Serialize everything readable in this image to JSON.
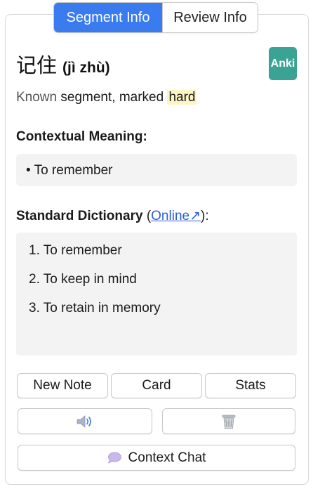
{
  "tabs": [
    {
      "label": "Segment Info",
      "active": true
    },
    {
      "label": "Review Info",
      "active": false
    }
  ],
  "word": {
    "hanzi": "记住",
    "pinyin": "(jì zhù)"
  },
  "anki_badge": "Anki",
  "status": {
    "part1": "Known",
    "part2": " segment, marked ",
    "tag": "hard"
  },
  "contextual": {
    "heading": "Contextual Meaning:",
    "item": "• To remember"
  },
  "dictionary": {
    "heading": "Standard Dictionary",
    "paren_open": " (",
    "link": "Online↗",
    "paren_close": "):",
    "definitions": [
      "1. To remember",
      "2. To keep in mind",
      "3. To retain in memory"
    ]
  },
  "buttons": {
    "new_note": "New Note",
    "card": "Card",
    "stats": "Stats",
    "audio_icon": "speaker-icon",
    "delete_icon": "trash-icon",
    "context_chat": "Context Chat",
    "context_chat_icon": "chat-bubble-icon"
  },
  "colors": {
    "accent": "#3a7bf0",
    "anki": "#3aa394",
    "highlight": "#fdf4c4",
    "box": "#f3f3f3"
  }
}
